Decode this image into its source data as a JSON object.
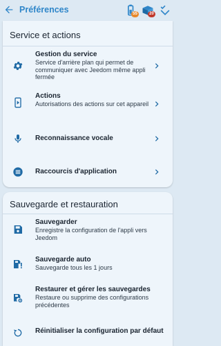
{
  "appbar": {
    "title": "Préférences",
    "badge_battery": "55",
    "badge_box": "20"
  },
  "colors": {
    "accent": "#2f86c9",
    "badge_orange": "#e8892b",
    "badge_red": "#c0392b"
  },
  "section_service": {
    "title": "Service et actions",
    "items": [
      {
        "icon": "gear-icon",
        "title": "Gestion du service",
        "subtitle": "Service d'arrière plan qui permet de communiquer avec Jeedom même appli fermée"
      },
      {
        "icon": "phone-play-icon",
        "title": "Actions",
        "subtitle": "Autorisations des actions sur cet appareil"
      },
      {
        "icon": "microphone-icon",
        "title": "Reconnaissance vocale",
        "subtitle": ""
      },
      {
        "icon": "list-circle-icon",
        "title": "Raccourcis d'application",
        "subtitle": ""
      }
    ]
  },
  "section_backup": {
    "title": "Sauvegarde et restauration",
    "items": [
      {
        "icon": "save-icon",
        "title": "Sauvegarder",
        "subtitle": "Enregistre la configuration de l'appli vers Jeedom"
      },
      {
        "icon": "save-alert-icon",
        "title": "Sauvegarde auto",
        "subtitle": "Sauvegarde tous les 1 jours"
      },
      {
        "icon": "save-settings-icon",
        "title": "Restaurer et gérer les sauvegardes",
        "subtitle": "Restaure ou supprime des configurations précédentes"
      },
      {
        "icon": "reset-icon",
        "title": "Réinitialiser la configuration par défaut",
        "subtitle": ""
      }
    ]
  }
}
